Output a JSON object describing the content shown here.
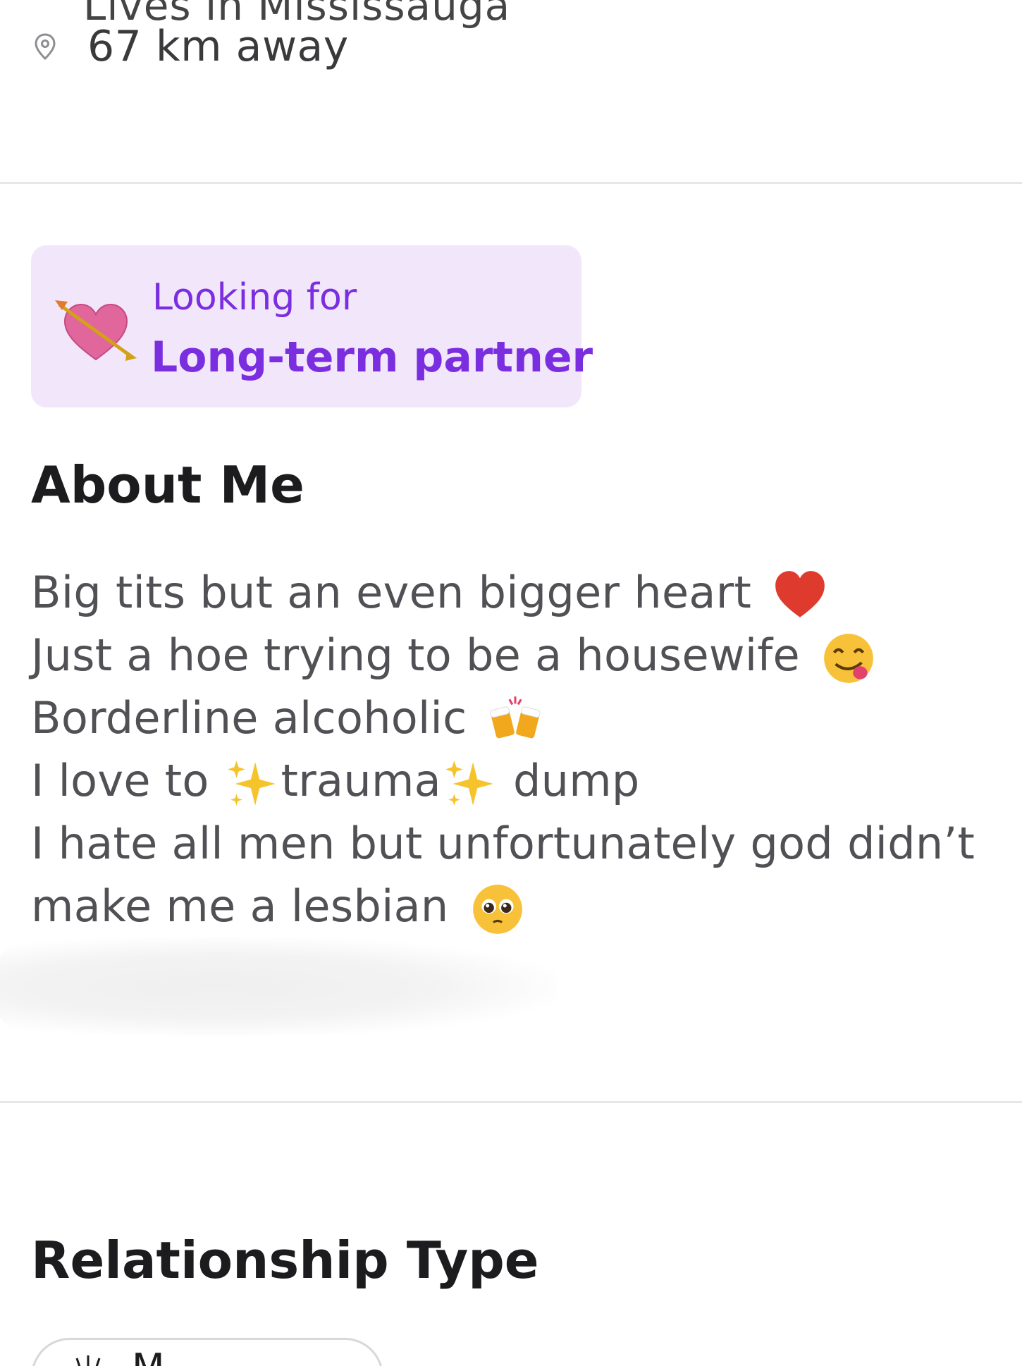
{
  "location": {
    "cutoff_text": "Lives in Mississauga",
    "distance": "67 km away"
  },
  "looking_for": {
    "label": "Looking for",
    "value": "Long-term partner",
    "icon": "heart-with-arrow-icon",
    "card_color": "#f2e6fb",
    "text_color": "#7a2ee0"
  },
  "about": {
    "title": "About Me",
    "lines": [
      {
        "text": "Big tits but an even bigger heart",
        "emoji": "red-heart-icon"
      },
      {
        "text": "Just a hoe trying to be a housewife",
        "emoji": "yum-face-icon"
      },
      {
        "text": "Borderline alcoholic",
        "emoji": "clinking-beer-mugs-icon"
      },
      {
        "before": "I love to ",
        "middle": "trauma",
        "after": " dump",
        "emoji": "sparkles-icon"
      },
      {
        "text": "I hate all men but unfortunately god didn’t"
      },
      {
        "text": "make me a lesbian",
        "emoji": "pleading-face-icon"
      }
    ]
  },
  "relationship": {
    "title": "Relationship Type",
    "chip_label": "M",
    "chip_icon": "chip-icon"
  }
}
